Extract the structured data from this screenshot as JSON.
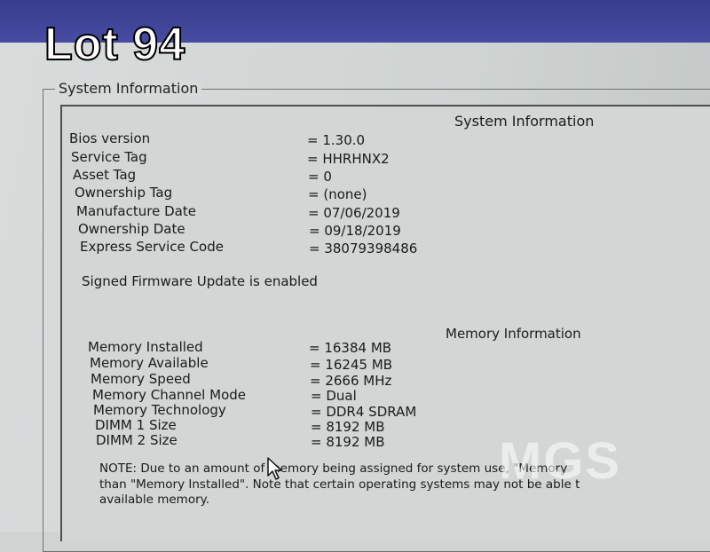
{
  "overlay": {
    "lot_label": "Lot 94"
  },
  "group_title": "System Information",
  "system": {
    "heading": "System Information",
    "rows": [
      {
        "label": "Bios version",
        "value": "= 1.30.0"
      },
      {
        "label": "Service Tag",
        "value": "= HHRHNX2"
      },
      {
        "label": "Asset Tag",
        "value": "= 0"
      },
      {
        "label": "Ownership Tag",
        "value": "= (none)"
      },
      {
        "label": "Manufacture Date",
        "value": "= 07/06/2019"
      },
      {
        "label": "Ownership Date",
        "value": "= 09/18/2019"
      },
      {
        "label": "Express Service Code",
        "value": "= 38079398486"
      }
    ],
    "firmware_status": "Signed Firmware Update is enabled"
  },
  "memory": {
    "heading": "Memory Information",
    "rows": [
      {
        "label": "Memory Installed",
        "value": "= 16384 MB"
      },
      {
        "label": "Memory Available",
        "value": "= 16245 MB"
      },
      {
        "label": "Memory Speed",
        "value": "= 2666 MHz"
      },
      {
        "label": "Memory Channel Mode",
        "value": "= Dual"
      },
      {
        "label": "Memory Technology",
        "value": "= DDR4 SDRAM"
      },
      {
        "label": "DIMM 1 Size",
        "value": "= 8192 MB"
      },
      {
        "label": "DIMM 2 Size",
        "value": "= 8192 MB"
      }
    ],
    "note_lines": [
      "NOTE: Due to an amount of memory being assigned for system use, \"Memory",
      "than \"Memory Installed\". Note that certain operating systems may not be able t",
      "available memory."
    ]
  },
  "watermark": "MGS",
  "colors": {
    "header_bar": "#3f4396",
    "screen_bg": "#cfd4d3",
    "text": "#1a1a1a"
  },
  "icons": {
    "pointer": "mouse-cursor-icon"
  }
}
